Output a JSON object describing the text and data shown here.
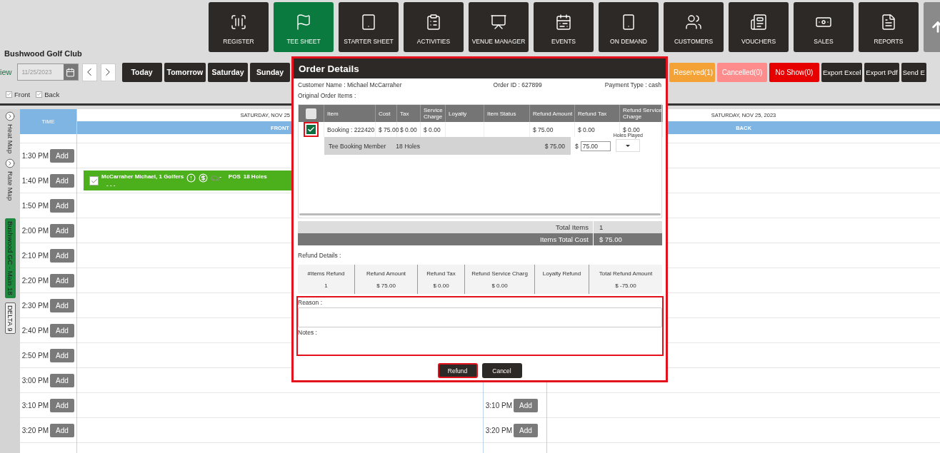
{
  "nav": [
    {
      "label": "REGISTER",
      "selected": false
    },
    {
      "label": "TEE SHEET",
      "selected": true
    },
    {
      "label": "STARTER SHEET",
      "selected": false
    },
    {
      "label": "ACTIVITIES",
      "selected": false
    },
    {
      "label": "VENUE MANAGER",
      "selected": false
    },
    {
      "label": "EVENTS",
      "selected": false
    },
    {
      "label": "ON DEMAND",
      "selected": false
    },
    {
      "label": "CUSTOMERS",
      "selected": false
    },
    {
      "label": "VOUCHERS",
      "selected": false
    },
    {
      "label": "SALES",
      "selected": false
    },
    {
      "label": "REPORTS",
      "selected": false
    }
  ],
  "club_name": "Bushwood Golf Club",
  "toolbar": {
    "view_label": "iew",
    "date": "11/25/2023",
    "quick_dates": [
      "Today",
      "Tomorrow",
      "Saturday",
      "Sunday"
    ],
    "status_filters": [
      {
        "label": "Reserved(1)",
        "color": "#f4a236"
      },
      {
        "label": "Cancelled(0)",
        "color": "#ff8c8c"
      },
      {
        "label": "No Show(0)",
        "color": "#e60000"
      }
    ],
    "actions": [
      "Export Excel",
      "Export Pdf",
      "Send E"
    ]
  },
  "course_filters": [
    {
      "label": "Front",
      "checked": true
    },
    {
      "label": "Back",
      "checked": true
    }
  ],
  "map_toggles": [
    "Heat Map",
    "Rate Map"
  ],
  "courses": [
    {
      "label": "Bushwood GC - Main 18",
      "selected": true
    },
    {
      "label": "DELTA 9",
      "selected": false
    }
  ],
  "time_header": "TIME",
  "front": {
    "date": "SATURDAY, NOV 25",
    "title": "FRONT"
  },
  "back": {
    "date": "SATURDAY, NOV 25, 2023",
    "title": "BACK"
  },
  "slots": [
    {
      "time": "1:30 PM",
      "action": "Add"
    },
    {
      "time": "1:40 PM",
      "action": "Add",
      "booking": {
        "name": "McCarraher Michael, 1 Golfers",
        "checked": true,
        "cart_status": "-",
        "source": "POS",
        "holes": "18 Holes",
        "note": "- - -"
      }
    },
    {
      "time": "1:50 PM",
      "action": "Add"
    },
    {
      "time": "2:00 PM",
      "action": "Add"
    },
    {
      "time": "2:10 PM",
      "action": "Add"
    },
    {
      "time": "2:20 PM",
      "action": "Add"
    },
    {
      "time": "2:30 PM",
      "action": "Add"
    },
    {
      "time": "2:40 PM",
      "action": "Add"
    },
    {
      "time": "2:50 PM",
      "action": "Add"
    },
    {
      "time": "3:00 PM",
      "action": "Add"
    },
    {
      "time": "3:10 PM",
      "action": "Add",
      "back_time": "3:10 PM",
      "back_action": "Add"
    },
    {
      "time": "3:20 PM",
      "action": "Add",
      "back_time": "3:20 PM",
      "back_action": "Add"
    }
  ],
  "dialog": {
    "title": "Order Details",
    "highlighted": true,
    "customer": "Customer Name : Michael McCarraher",
    "order_id": "Order ID : 627899",
    "payment": "Payment Type : cash",
    "items_label": "Original Order Items :",
    "select_all": {
      "checked": false
    },
    "columns": [
      "Item",
      "Cost",
      "Tax",
      "Service Charge",
      "Loyalty",
      "Item Status",
      "Refund Amount",
      "Refund Tax",
      "Refund Service Charge"
    ],
    "rows": [
      {
        "checked": true,
        "highlighted": true,
        "item": "Booking : 222420",
        "cost": "$ 75.00",
        "tax": "$ 0.00",
        "service_charge": "$ 0.00",
        "refund_amount": "$ 75.00",
        "refund_tax": "$ 0.00",
        "refund_service_charge": "$ 0.00",
        "detail": {
          "description": "Tee Booking Member",
          "holes": "18 Holes",
          "price": "$ 75.00",
          "currency": "$",
          "refund_value": "75.00",
          "holes_played_label": "Holes Played"
        }
      }
    ],
    "totals": [
      {
        "label": "Total Items",
        "value": "1"
      },
      {
        "label": "Items Total Cost",
        "value": "$ 75.00"
      }
    ],
    "refund_label": "Refund Details :",
    "refund_summary": [
      {
        "label": "#Items Refund",
        "value": "1"
      },
      {
        "label": "Refund Amount",
        "value": "$ 75.00"
      },
      {
        "label": "Refund Tax",
        "value": "$ 0.00"
      },
      {
        "label": "Refund Service Charg",
        "value": "$ 0.00"
      },
      {
        "label": "Loyalty Refund"
      },
      {
        "label": "Total Refund Amount",
        "value": "$ -75.00"
      }
    ],
    "notes_highlighted": true,
    "reason_label": "Reason :",
    "notes_label": "Notes :",
    "buttons": [
      {
        "label": "Refund",
        "highlighted": true
      },
      {
        "label": "Cancel",
        "highlighted": false
      }
    ]
  }
}
